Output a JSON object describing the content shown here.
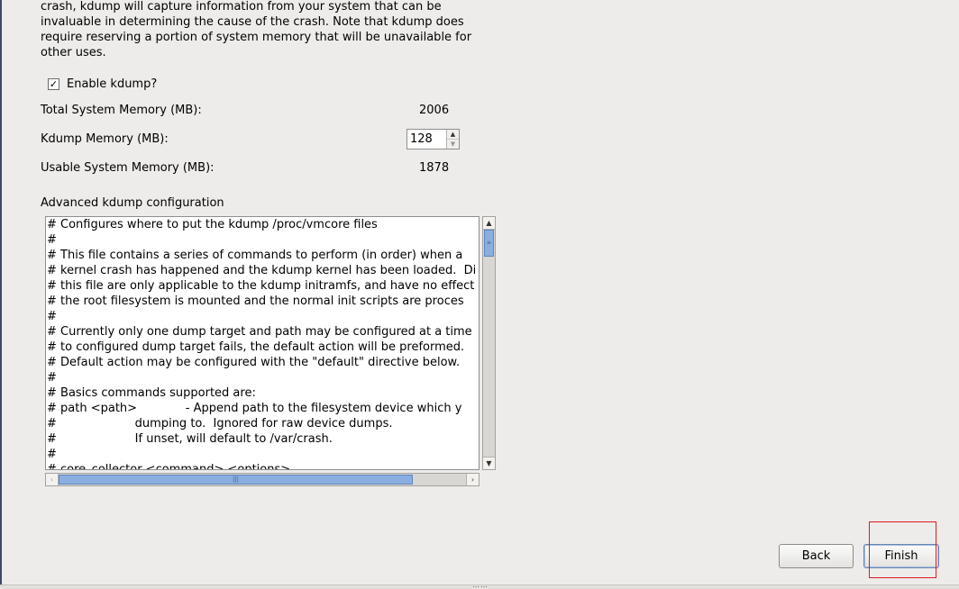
{
  "intro_lines": [
    "crash, kdump will capture information from your system that can be",
    "invaluable in determining the cause of the crash. Note that kdump does",
    "require reserving a portion of system memory that will be unavailable for",
    "other uses."
  ],
  "enable_kdump": {
    "label": "Enable kdump?",
    "checked_glyph": "✓"
  },
  "memory": {
    "total_label": "Total System Memory (MB):",
    "total_value": "2006",
    "kdump_label": "Kdump Memory (MB):",
    "kdump_value": "128",
    "usable_label": "Usable System Memory (MB):",
    "usable_value": "1878"
  },
  "advanced": {
    "title": "Advanced kdump configuration",
    "lines": [
      "# Configures where to put the kdump /proc/vmcore files",
      "#",
      "# This file contains a series of commands to perform (in order) when a",
      "# kernel crash has happened and the kdump kernel has been loaded.  Di",
      "# this file are only applicable to the kdump initramfs, and have no effect",
      "# the root filesystem is mounted and the normal init scripts are proces",
      "#",
      "# Currently only one dump target and path may be configured at a time",
      "# to configured dump target fails, the default action will be preformed.",
      "# Default action may be configured with the \"default\" directive below.",
      "#",
      "# Basics commands supported are:",
      "# path <path>             - Append path to the filesystem device which y",
      "#                     dumping to.  Ignored for raw device dumps.",
      "#                     If unset, will default to /var/crash.",
      "#",
      "# core_collector <command> <options>"
    ]
  },
  "buttons": {
    "back": "Back",
    "finish": "Finish"
  },
  "icons": {
    "spin_up": "▲",
    "spin_down": "▼",
    "scroll_up": "▲",
    "scroll_down": "▼",
    "scroll_left": "‹",
    "scroll_right": "›",
    "grip_vertical": "≡",
    "grip_horizontal": "|||",
    "grip_bottom": "……"
  }
}
